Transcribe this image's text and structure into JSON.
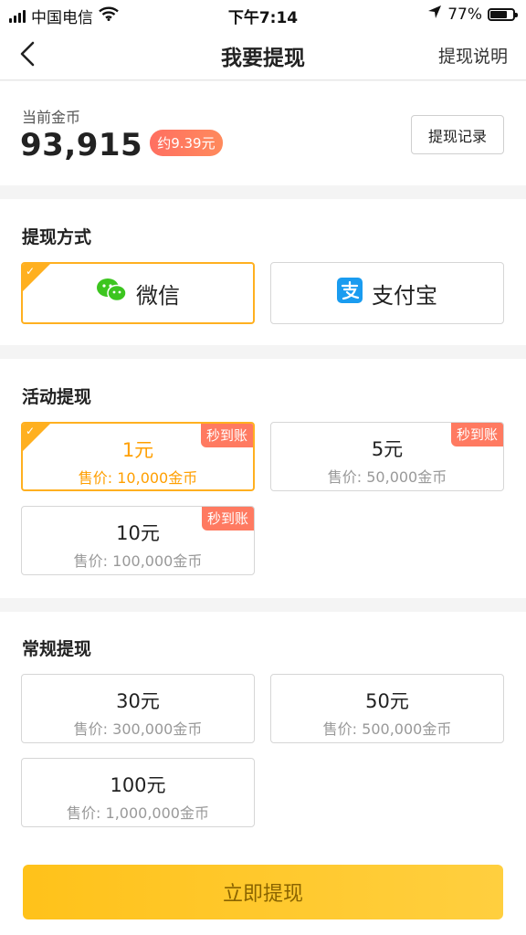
{
  "status_bar": {
    "carrier": "中国电信",
    "time": "下午7:14",
    "battery": "77%",
    "battery_level": 0.77
  },
  "nav": {
    "title": "我要提现",
    "help": "提现说明"
  },
  "balance": {
    "label": "当前金币",
    "amount": "93,915",
    "approx": "约9.39元",
    "record_button": "提现记录"
  },
  "payment": {
    "title": "提现方式",
    "options": [
      {
        "label": "微信",
        "icon": "wechat-icon",
        "selected": true
      },
      {
        "label": "支付宝",
        "icon": "alipay-icon",
        "selected": false
      }
    ]
  },
  "activity": {
    "title": "活动提现",
    "items": [
      {
        "amount": "1元",
        "price": "售价: 10,000金币",
        "badge": "秒到账",
        "selected": true
      },
      {
        "amount": "5元",
        "price": "售价: 50,000金币",
        "badge": "秒到账",
        "selected": false
      },
      {
        "amount": "10元",
        "price": "售价: 100,000金币",
        "badge": "秒到账",
        "selected": false
      }
    ]
  },
  "regular": {
    "title": "常规提现",
    "items": [
      {
        "amount": "30元",
        "price": "售价: 300,000金币"
      },
      {
        "amount": "50元",
        "price": "售价: 500,000金币"
      },
      {
        "amount": "100元",
        "price": "售价: 1,000,000金币"
      }
    ]
  },
  "submit_label": "立即提现",
  "colors": {
    "accent": "#ffb020",
    "badge": "#ff7a61",
    "wechat": "#3cc51f",
    "alipay": "#1a9cf0"
  }
}
